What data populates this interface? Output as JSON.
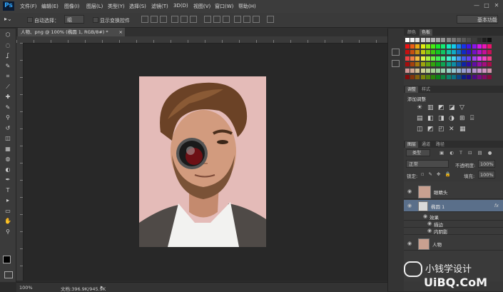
{
  "app": {
    "logo": "Ps"
  },
  "menu": {
    "items": [
      "文件(F)",
      "编辑(E)",
      "图像(I)",
      "图层(L)",
      "类型(Y)",
      "选择(S)",
      "滤镜(T)",
      "3D(D)",
      "视图(V)",
      "窗口(W)",
      "帮助(H)"
    ]
  },
  "window_controls": {
    "minimize": "—",
    "maximize": "□",
    "close": "✕"
  },
  "options_bar": {
    "auto_select_label": "自动选择：",
    "auto_select_value": "组",
    "show_transform_label": "显示变换控件",
    "workspace": "基本功能"
  },
  "document": {
    "tab_title": "人物、png @ 100% (椭圆 1, RGB/8#) *",
    "close": "×"
  },
  "status": {
    "zoom": "100%",
    "doc_info": "文档:396.9K/945.9K"
  },
  "tools": [
    "move-icon",
    "marquee-icon",
    "lasso-icon",
    "quick-select-icon",
    "crop-icon",
    "eyedropper-icon",
    "healing-icon",
    "brush-icon",
    "stamp-icon",
    "history-brush-icon",
    "eraser-icon",
    "gradient-icon",
    "blur-icon",
    "dodge-icon",
    "pen-icon",
    "type-icon",
    "path-select-icon",
    "shape-icon",
    "hand-icon",
    "zoom-icon"
  ],
  "panels": {
    "color_tabs": [
      "颜色",
      "色板"
    ],
    "adjust_tabs": [
      "调整",
      "样式"
    ],
    "adjust_title": "添加调整",
    "layers_tabs": [
      "图层",
      "通道",
      "路径"
    ],
    "filter_kind": "类型",
    "blend_mode": "正常",
    "opacity_label": "不透明度:",
    "opacity_value": "100%",
    "lock_label": "锁定:",
    "fill_label": "填充:",
    "fill_value": "100%",
    "layers": [
      {
        "name": "眼睛头",
        "fx": false
      },
      {
        "name": "椭圆 1",
        "fx": true
      },
      {
        "name": "效果",
        "fx": false
      },
      {
        "name": "描边",
        "fx": false
      },
      {
        "name": "内阴影",
        "fx": false
      },
      {
        "name": "人物",
        "fx": false
      }
    ]
  },
  "watermark": {
    "cn": "小钱学设计",
    "logo": "UiBQ.CoM"
  },
  "colors": {
    "accent": "#31a8ff",
    "selected_layer": "#5a6f8a"
  }
}
